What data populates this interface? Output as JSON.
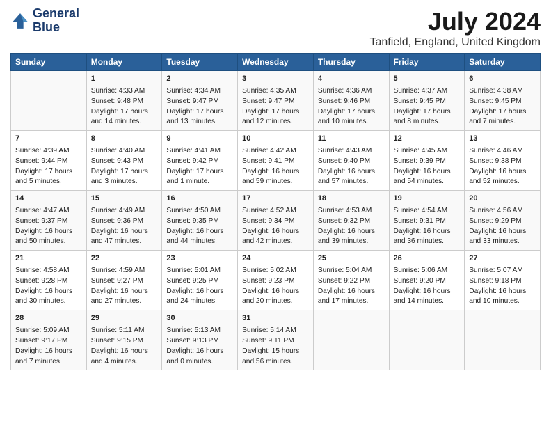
{
  "header": {
    "logo_line1": "General",
    "logo_line2": "Blue",
    "title": "July 2024",
    "subtitle": "Tanfield, England, United Kingdom"
  },
  "columns": [
    "Sunday",
    "Monday",
    "Tuesday",
    "Wednesday",
    "Thursday",
    "Friday",
    "Saturday"
  ],
  "rows": [
    [
      {
        "day": "",
        "lines": []
      },
      {
        "day": "1",
        "lines": [
          "Sunrise: 4:33 AM",
          "Sunset: 9:48 PM",
          "Daylight: 17 hours",
          "and 14 minutes."
        ]
      },
      {
        "day": "2",
        "lines": [
          "Sunrise: 4:34 AM",
          "Sunset: 9:47 PM",
          "Daylight: 17 hours",
          "and 13 minutes."
        ]
      },
      {
        "day": "3",
        "lines": [
          "Sunrise: 4:35 AM",
          "Sunset: 9:47 PM",
          "Daylight: 17 hours",
          "and 12 minutes."
        ]
      },
      {
        "day": "4",
        "lines": [
          "Sunrise: 4:36 AM",
          "Sunset: 9:46 PM",
          "Daylight: 17 hours",
          "and 10 minutes."
        ]
      },
      {
        "day": "5",
        "lines": [
          "Sunrise: 4:37 AM",
          "Sunset: 9:45 PM",
          "Daylight: 17 hours",
          "and 8 minutes."
        ]
      },
      {
        "day": "6",
        "lines": [
          "Sunrise: 4:38 AM",
          "Sunset: 9:45 PM",
          "Daylight: 17 hours",
          "and 7 minutes."
        ]
      }
    ],
    [
      {
        "day": "7",
        "lines": [
          "Sunrise: 4:39 AM",
          "Sunset: 9:44 PM",
          "Daylight: 17 hours",
          "and 5 minutes."
        ]
      },
      {
        "day": "8",
        "lines": [
          "Sunrise: 4:40 AM",
          "Sunset: 9:43 PM",
          "Daylight: 17 hours",
          "and 3 minutes."
        ]
      },
      {
        "day": "9",
        "lines": [
          "Sunrise: 4:41 AM",
          "Sunset: 9:42 PM",
          "Daylight: 17 hours",
          "and 1 minute."
        ]
      },
      {
        "day": "10",
        "lines": [
          "Sunrise: 4:42 AM",
          "Sunset: 9:41 PM",
          "Daylight: 16 hours",
          "and 59 minutes."
        ]
      },
      {
        "day": "11",
        "lines": [
          "Sunrise: 4:43 AM",
          "Sunset: 9:40 PM",
          "Daylight: 16 hours",
          "and 57 minutes."
        ]
      },
      {
        "day": "12",
        "lines": [
          "Sunrise: 4:45 AM",
          "Sunset: 9:39 PM",
          "Daylight: 16 hours",
          "and 54 minutes."
        ]
      },
      {
        "day": "13",
        "lines": [
          "Sunrise: 4:46 AM",
          "Sunset: 9:38 PM",
          "Daylight: 16 hours",
          "and 52 minutes."
        ]
      }
    ],
    [
      {
        "day": "14",
        "lines": [
          "Sunrise: 4:47 AM",
          "Sunset: 9:37 PM",
          "Daylight: 16 hours",
          "and 50 minutes."
        ]
      },
      {
        "day": "15",
        "lines": [
          "Sunrise: 4:49 AM",
          "Sunset: 9:36 PM",
          "Daylight: 16 hours",
          "and 47 minutes."
        ]
      },
      {
        "day": "16",
        "lines": [
          "Sunrise: 4:50 AM",
          "Sunset: 9:35 PM",
          "Daylight: 16 hours",
          "and 44 minutes."
        ]
      },
      {
        "day": "17",
        "lines": [
          "Sunrise: 4:52 AM",
          "Sunset: 9:34 PM",
          "Daylight: 16 hours",
          "and 42 minutes."
        ]
      },
      {
        "day": "18",
        "lines": [
          "Sunrise: 4:53 AM",
          "Sunset: 9:32 PM",
          "Daylight: 16 hours",
          "and 39 minutes."
        ]
      },
      {
        "day": "19",
        "lines": [
          "Sunrise: 4:54 AM",
          "Sunset: 9:31 PM",
          "Daylight: 16 hours",
          "and 36 minutes."
        ]
      },
      {
        "day": "20",
        "lines": [
          "Sunrise: 4:56 AM",
          "Sunset: 9:29 PM",
          "Daylight: 16 hours",
          "and 33 minutes."
        ]
      }
    ],
    [
      {
        "day": "21",
        "lines": [
          "Sunrise: 4:58 AM",
          "Sunset: 9:28 PM",
          "Daylight: 16 hours",
          "and 30 minutes."
        ]
      },
      {
        "day": "22",
        "lines": [
          "Sunrise: 4:59 AM",
          "Sunset: 9:27 PM",
          "Daylight: 16 hours",
          "and 27 minutes."
        ]
      },
      {
        "day": "23",
        "lines": [
          "Sunrise: 5:01 AM",
          "Sunset: 9:25 PM",
          "Daylight: 16 hours",
          "and 24 minutes."
        ]
      },
      {
        "day": "24",
        "lines": [
          "Sunrise: 5:02 AM",
          "Sunset: 9:23 PM",
          "Daylight: 16 hours",
          "and 20 minutes."
        ]
      },
      {
        "day": "25",
        "lines": [
          "Sunrise: 5:04 AM",
          "Sunset: 9:22 PM",
          "Daylight: 16 hours",
          "and 17 minutes."
        ]
      },
      {
        "day": "26",
        "lines": [
          "Sunrise: 5:06 AM",
          "Sunset: 9:20 PM",
          "Daylight: 16 hours",
          "and 14 minutes."
        ]
      },
      {
        "day": "27",
        "lines": [
          "Sunrise: 5:07 AM",
          "Sunset: 9:18 PM",
          "Daylight: 16 hours",
          "and 10 minutes."
        ]
      }
    ],
    [
      {
        "day": "28",
        "lines": [
          "Sunrise: 5:09 AM",
          "Sunset: 9:17 PM",
          "Daylight: 16 hours",
          "and 7 minutes."
        ]
      },
      {
        "day": "29",
        "lines": [
          "Sunrise: 5:11 AM",
          "Sunset: 9:15 PM",
          "Daylight: 16 hours",
          "and 4 minutes."
        ]
      },
      {
        "day": "30",
        "lines": [
          "Sunrise: 5:13 AM",
          "Sunset: 9:13 PM",
          "Daylight: 16 hours",
          "and 0 minutes."
        ]
      },
      {
        "day": "31",
        "lines": [
          "Sunrise: 5:14 AM",
          "Sunset: 9:11 PM",
          "Daylight: 15 hours",
          "and 56 minutes."
        ]
      },
      {
        "day": "",
        "lines": []
      },
      {
        "day": "",
        "lines": []
      },
      {
        "day": "",
        "lines": []
      }
    ]
  ]
}
